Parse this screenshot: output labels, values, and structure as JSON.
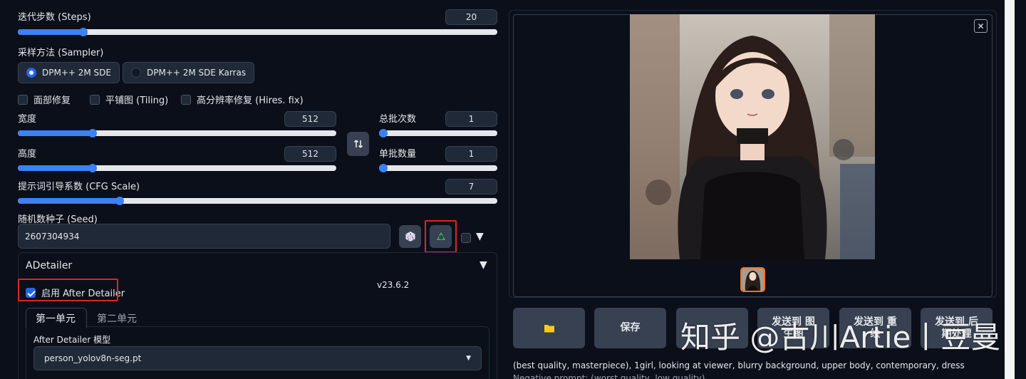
{
  "steps": {
    "label": "迭代步数 (Steps)",
    "value": "20",
    "fraction": 0.13
  },
  "sampler": {
    "label": "采样方法 (Sampler)",
    "options": [
      "DPM++ 2M SDE",
      "DPM++ 2M SDE Karras"
    ],
    "selected": "DPM++ 2M SDE"
  },
  "checkboxes": {
    "restore_faces": "面部修复",
    "tiling": "平铺图 (Tiling)",
    "hires_fix": "高分辨率修复 (Hires. fix)"
  },
  "width": {
    "label": "宽度",
    "value": "512",
    "fraction": 0.23
  },
  "height": {
    "label": "高度",
    "value": "512",
    "fraction": 0.23
  },
  "batch_count": {
    "label": "总批次数",
    "value": "1",
    "fraction": 0.0
  },
  "batch_size": {
    "label": "单批数量",
    "value": "1",
    "fraction": 0.0
  },
  "cfg": {
    "label": "提示词引导系数 (CFG Scale)",
    "value": "7",
    "fraction": 0.21
  },
  "seed": {
    "label": "随机数种子 (Seed)",
    "value": "2607304934"
  },
  "adetailer": {
    "title": "ADetailer",
    "enable_label": "启用 After Detailer",
    "version": "v23.6.2",
    "tabs": [
      "第一单元",
      "第二单元"
    ],
    "model_label": "After Detailer 模型",
    "model_value": "person_yolov8n-seg.pt"
  },
  "actions": [
    "保存",
    "发送到 图生图",
    "发送到 重绘",
    "发送到 后期处理"
  ],
  "prompt_text": "(best quality, masterpiece), 1girl, looking at viewer, blurry background, upper body, contemporary, dress",
  "negative_text": "Negative prompt: (worst quality, low quality)",
  "watermark": "知乎 @古川Artie丨豆曼",
  "icons": {
    "swap": "swap-icon",
    "dice": "dice-icon",
    "recycle": "recycle-icon",
    "folder": "folder-icon",
    "close": "close-icon"
  }
}
